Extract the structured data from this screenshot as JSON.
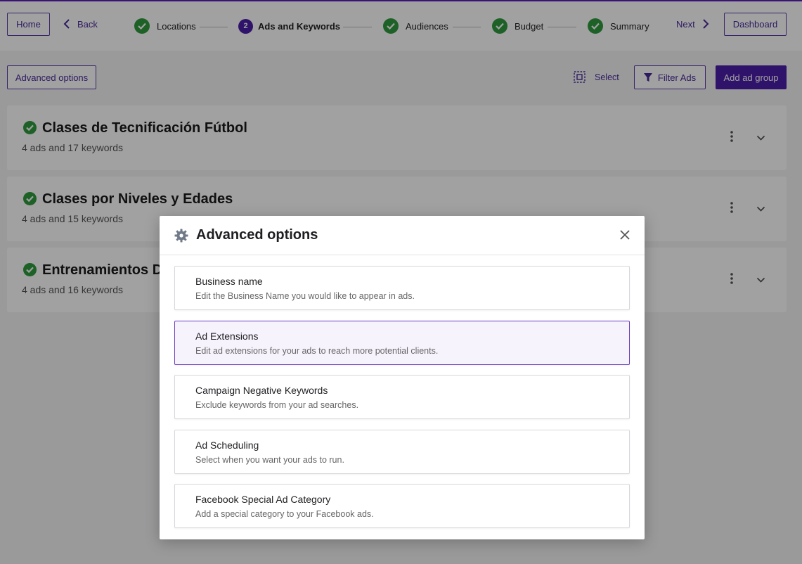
{
  "nav": {
    "home": "Home",
    "back": "Back",
    "next": "Next",
    "dashboard": "Dashboard",
    "steps": [
      {
        "label": "Locations",
        "status": "done"
      },
      {
        "label": "Ads and Keywords",
        "status": "current",
        "number": "2"
      },
      {
        "label": "Audiences",
        "status": "done"
      },
      {
        "label": "Budget",
        "status": "done"
      },
      {
        "label": "Summary",
        "status": "done"
      }
    ]
  },
  "toolbar": {
    "advanced_options": "Advanced options",
    "select": "Select",
    "filter_ads": "Filter Ads",
    "add_ad_group": "Add ad group"
  },
  "ad_groups": [
    {
      "title": "Clases de Tecnificación Fútbol",
      "summary": "4 ads and 17 keywords"
    },
    {
      "title": "Clases por Niveles y Edades",
      "summary": "4 ads and 15 keywords"
    },
    {
      "title": "Entrenamientos D",
      "summary": "4 ads and 16 keywords"
    }
  ],
  "modal": {
    "title": "Advanced options",
    "options": [
      {
        "title": "Business name",
        "description": "Edit the Business Name you would like to appear in ads."
      },
      {
        "title": "Ad Extensions",
        "description": "Edit ad extensions for your ads to reach more potential clients."
      },
      {
        "title": "Campaign Negative Keywords",
        "description": "Exclude keywords from your ad searches."
      },
      {
        "title": "Ad Scheduling",
        "description": "Select when you want your ads to run."
      },
      {
        "title": "Facebook Special Ad Category",
        "description": "Add a special category to your Facebook ads."
      }
    ]
  },
  "colors": {
    "brand": "#4b1ea8",
    "success": "#2e9a3f",
    "overlay": "rgba(0,0,0,0.37)"
  }
}
